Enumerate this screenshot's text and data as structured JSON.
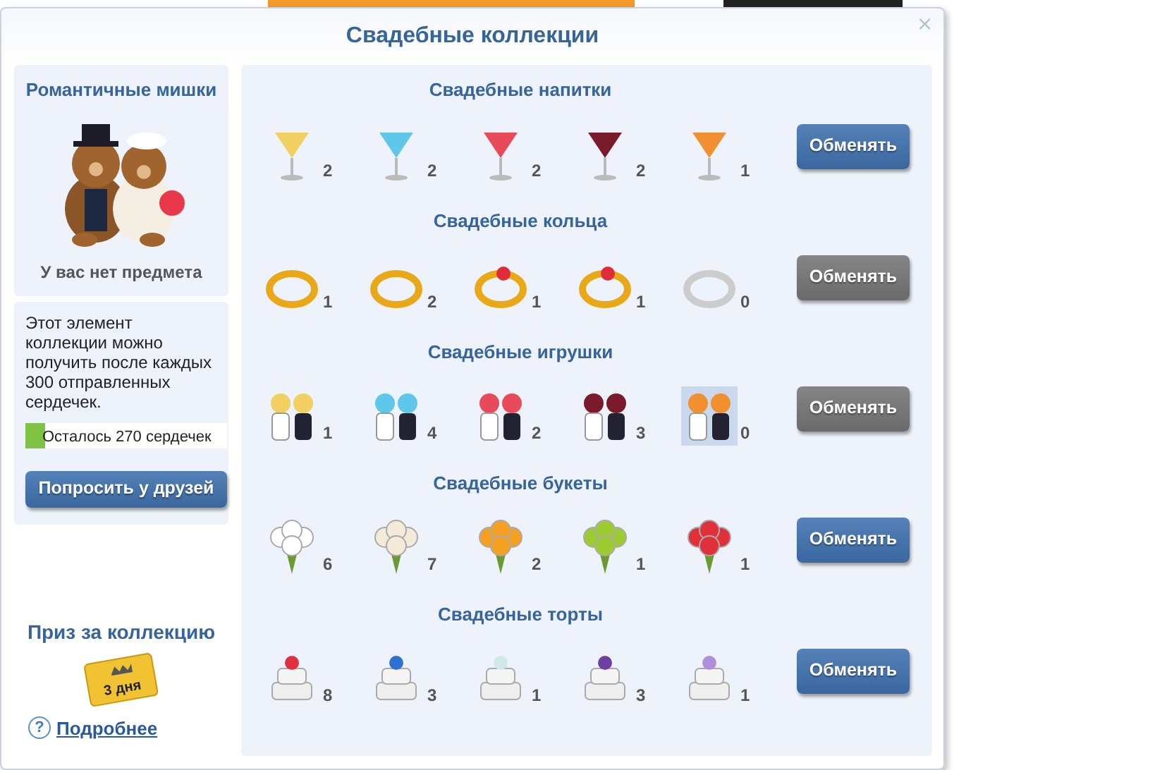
{
  "dialog": {
    "title": "Свадебные коллекции",
    "close": "×"
  },
  "item_card": {
    "title": "Романтичные мишки",
    "status": "У вас нет предмета"
  },
  "info": {
    "text": "Этот элемент коллекции можно получить после каждых 300 отправленных сердечек.",
    "progress": {
      "level": 0.1,
      "reading": "Осталось 270 сердечек"
    },
    "button": "Попросить у друзей"
  },
  "prize": {
    "title": "Приз за коллекцию",
    "ticket_text": "3 дня",
    "help": "?",
    "link": "Подробнее"
  },
  "collections": [
    {
      "title": "Свадебные напитки",
      "kind": "drink",
      "button": "Обменять",
      "enabled": true,
      "items": [
        {
          "count": "2",
          "selected": false
        },
        {
          "count": "2",
          "selected": false
        },
        {
          "count": "2",
          "selected": false
        },
        {
          "count": "2",
          "selected": false
        },
        {
          "count": "1",
          "selected": false
        }
      ]
    },
    {
      "title": "Свадебные кольца",
      "kind": "ring",
      "button": "Обменять",
      "enabled": false,
      "items": [
        {
          "count": "1",
          "selected": false
        },
        {
          "count": "2",
          "selected": false
        },
        {
          "count": "1",
          "selected": false
        },
        {
          "count": "1",
          "selected": false
        },
        {
          "count": "0",
          "selected": false
        }
      ]
    },
    {
      "title": "Свадебные игрушки",
      "kind": "couple",
      "button": "Обменять",
      "enabled": false,
      "items": [
        {
          "count": "1",
          "selected": false
        },
        {
          "count": "4",
          "selected": false
        },
        {
          "count": "2",
          "selected": false
        },
        {
          "count": "3",
          "selected": false
        },
        {
          "count": "0",
          "selected": true
        }
      ]
    },
    {
      "title": "Свадебные букеты",
      "kind": "bouquet",
      "button": "Обменять",
      "enabled": true,
      "items": [
        {
          "count": "6",
          "selected": false
        },
        {
          "count": "7",
          "selected": false
        },
        {
          "count": "2",
          "selected": false
        },
        {
          "count": "1",
          "selected": false
        },
        {
          "count": "1",
          "selected": false
        }
      ]
    },
    {
      "title": "Свадебные торты",
      "kind": "cake",
      "button": "Обменять",
      "enabled": true,
      "items": [
        {
          "count": "8",
          "selected": false
        },
        {
          "count": "3",
          "selected": false
        },
        {
          "count": "1",
          "selected": false
        },
        {
          "count": "3",
          "selected": false
        },
        {
          "count": "1",
          "selected": false
        }
      ]
    }
  ]
}
